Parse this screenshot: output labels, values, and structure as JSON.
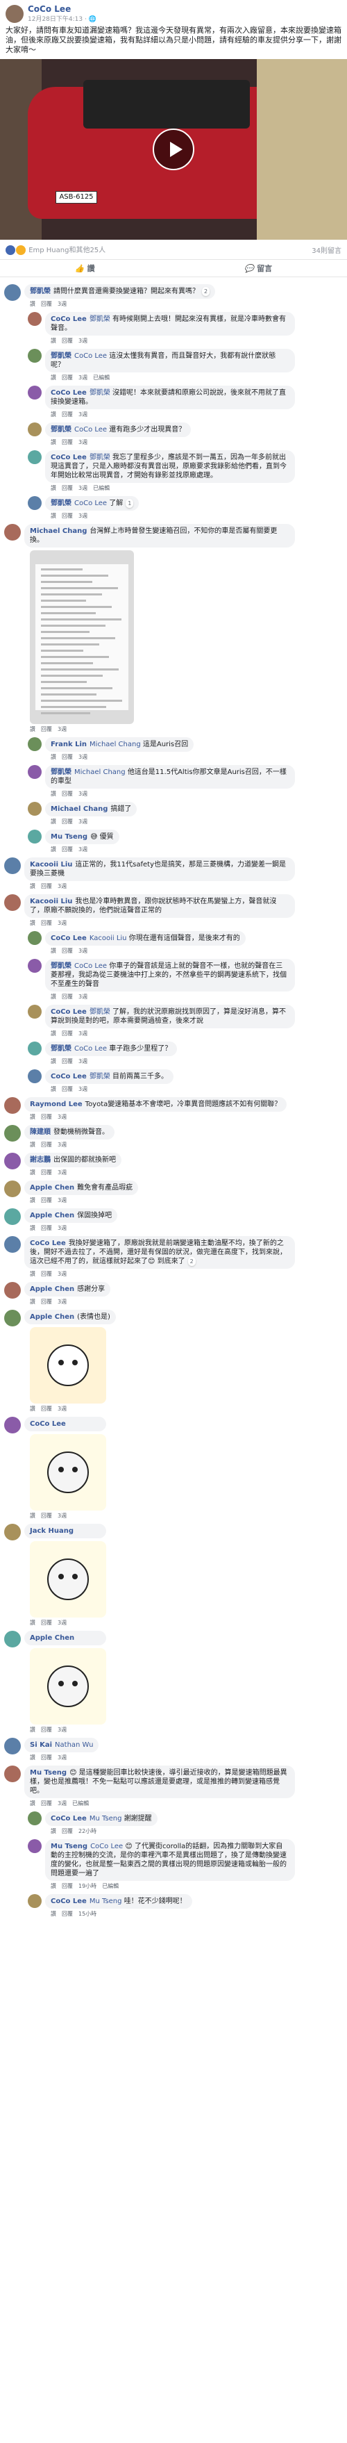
{
  "post": {
    "author": "CoCo Lee",
    "time": "12月28日下午4:13 · 🌐",
    "text": "大家好，請問有車友知道漏變速箱嗎？我這邊今天發現有異常，有兩次入廠留意，本來說要換變速箱油，但後來原廠又說要換變速箱，我有點詳細以為只是小問題，請有經驗的車友提供分享一下，謝謝大家唷～",
    "plate": "ASB-6125",
    "reactions": {
      "summary": "Emp Huang和其他25人",
      "comments": "34則留言"
    },
    "like_label": "讚",
    "comment_label": "留言"
  },
  "comments": [
    {
      "name": "鄧凱榮",
      "text": "請問什麼異音還需要換變速箱？開起來有異嗎？",
      "foot": [
        "讚",
        "回覆",
        "3週"
      ],
      "badge": "2"
    },
    {
      "name": "CoCo Lee",
      "tag": "鄧凱榮",
      "text": "有時候剛開上去哦！開起來沒有異樣，就是冷車時數會有聲音。",
      "foot": [
        "讚",
        "回覆",
        "3週"
      ]
    },
    {
      "name": "鄧凱榮",
      "tag": "CoCo Lee",
      "text": "這沒太懂我有異音，而且聲音好大，我都有說什麼狀態呢？",
      "foot": [
        "讚",
        "回覆",
        "3週",
        "已編輯"
      ]
    },
    {
      "name": "CoCo Lee",
      "tag": "鄧凱榮",
      "text": "沒錯呢！本來就要請和原廠公司說說，後來就不用就了直接換變速箱。",
      "foot": [
        "讚",
        "回覆",
        "3週"
      ]
    },
    {
      "name": "鄧凱榮",
      "tag": "CoCo Lee",
      "text": "還有跑多少才出現異音？",
      "foot": [
        "讚",
        "回覆",
        "3週"
      ]
    },
    {
      "name": "CoCo Lee",
      "tag": "鄧凱榮",
      "text": "我忘了里程多少，應該是不到一萬五，因為一年多前就出現這異音了，只是入廠時都沒有異音出現，原廠要求我錄影給他們看，直到今年開始比較常出現異音，才開始有錄影並找原廠處理。",
      "foot": [
        "讚",
        "回覆",
        "3週",
        "已編輯"
      ]
    },
    {
      "name": "鄧凱榮",
      "tag": "CoCo Lee",
      "text": "了解",
      "foot": [
        "讚",
        "回覆",
        "3週"
      ],
      "badge": "1"
    },
    {
      "name": "Michael Chang",
      "text": "台灣鮮上市時曾發生變速箱召回，不知你的車是否屬有關要更換。",
      "foot": [
        "讚",
        "回覆",
        "3週"
      ]
    },
    {
      "name": "Frank Lin",
      "tag": "Michael Chang",
      "text": "這是Auris召回",
      "foot": [
        "讚",
        "回覆",
        "3週"
      ]
    },
    {
      "name": "鄧凱榮",
      "tag": "Michael Chang",
      "text": "他這台是11.5代Altis你那文章是Auris召回，不一樣的車型",
      "foot": [
        "讚",
        "回覆",
        "3週"
      ]
    },
    {
      "name": "Michael Chang",
      "text": "搞錯了",
      "foot": [
        "讚",
        "回覆",
        "3週"
      ]
    },
    {
      "name": "Mu Tseng",
      "text": "😅 優質",
      "foot": [
        "讚",
        "回覆",
        "3週"
      ]
    },
    {
      "name": "Kacooii Liu",
      "text": "這正常的，我11代safety也是搞笑，那是三菱機構，力道變差一鋼是要換三菱機",
      "foot": [
        "讚",
        "回覆",
        "3週"
      ]
    },
    {
      "name": "Kacooii Liu",
      "text": "我也是冷車時數異音，跟你說狀態時不狀在馬變蠻上方，聲音就沒了，原廠不願說換的，他們說這聲音正常的",
      "foot": [
        "讚",
        "回覆",
        "3週"
      ]
    },
    {
      "name": "CoCo Lee",
      "tag": "Kacooii Liu",
      "text": "你現在還有這個聲音，是後來才有的",
      "foot": [
        "讚",
        "回覆",
        "3週"
      ]
    },
    {
      "name": "鄧凱榮",
      "tag": "CoCo Lee",
      "text": "你車子的聲音該是這上就的聲音不一樣，也就的聲音在三菱那裡，我認為從三菱機油中打上來的，不然拿些平的鋼再變速系統下，找個不至產生的聲音",
      "foot": [
        "讚",
        "回覆",
        "3週"
      ]
    },
    {
      "name": "CoCo Lee",
      "tag": "鄧凱榮",
      "text": "了解，我的狀況原廠說找到原因了，算是沒好消息，算不算說到換是對的吧，原本需要開過檢查，後來才說",
      "foot": [
        "讚",
        "回覆",
        "3週"
      ]
    },
    {
      "name": "鄧凱榮",
      "tag": "CoCo Lee",
      "text": "車子跑多少里程了？",
      "foot": [
        "讚",
        "回覆",
        "3週"
      ]
    },
    {
      "name": "CoCo Lee",
      "tag": "鄧凱榮",
      "text": "目前兩萬三千多。",
      "foot": [
        "讚",
        "回覆",
        "3週"
      ]
    },
    {
      "name": "Raymond Lee",
      "text": "Toyota變速箱基本不會壞吧，冷車異音問題應該不如有何關聯？",
      "foot": [
        "讚",
        "回覆",
        "3週"
      ]
    },
    {
      "name": "陳建順",
      "text": "發動機稍微聲音。",
      "foot": [
        "讚",
        "回覆",
        "3週"
      ]
    },
    {
      "name": "謝志鵬",
      "text": "出保固的都就換新吧",
      "foot": [
        "讚",
        "回覆",
        "3週"
      ]
    },
    {
      "name": "Apple Chen",
      "text": "難免會有產品瑕疵",
      "foot": [
        "讚",
        "回覆",
        "3週"
      ]
    },
    {
      "name": "Apple Chen",
      "text": "保固換掉吧",
      "foot": [
        "讚",
        "回覆",
        "3週"
      ]
    },
    {
      "name": "CoCo Lee",
      "text": "我換好變速箱了，原廠說我就是前端變速箱主動油壓不均，換了新的之後，開好不過去拉了，不過開，還好是有保固的狀況，做完還在高度下，找到來說，這次已經不用了的，就這樣就好起來了😊 到底來了",
      "foot": [
        "讚",
        "回覆",
        "3週"
      ],
      "badge": "2"
    },
    {
      "name": "Apple Chen",
      "text": "感謝分享",
      "foot": [
        "讚",
        "回覆",
        "3週"
      ]
    },
    {
      "name": "Apple Chen",
      "text": "(表情也是)",
      "foot": [
        "讚",
        "回覆",
        "3週"
      ]
    },
    {
      "name": "CoCo Lee",
      "text": "",
      "foot": [
        "讚",
        "回覆",
        "3週"
      ]
    },
    {
      "name": "Jack Huang",
      "text": "",
      "foot": [
        "讚",
        "回覆",
        "3週"
      ]
    },
    {
      "name": "Apple Chen",
      "text": "",
      "foot": [
        "讚",
        "回覆",
        "3週"
      ]
    },
    {
      "name": "Si Kai",
      "tag": "Nathan Wu",
      "text": "",
      "foot": [
        "讚",
        "回覆",
        "3週"
      ]
    },
    {
      "name": "Mu Tseng",
      "text": "😊 是這種變能回車比較快速後，導引最近接收的，算是變速箱問題最異樣，變也是推薦哦！不免一點點可以應該還是要處理，或是推推的轉到變速箱感覺吧。",
      "foot": [
        "讚",
        "回覆",
        "3週",
        "已編輯"
      ]
    },
    {
      "name": "CoCo Lee",
      "tag": "Mu Tseng",
      "text": "謝謝提醒",
      "foot": [
        "讚",
        "回覆",
        "22小時"
      ]
    },
    {
      "name": "Mu Tseng",
      "tag": "CoCo Lee",
      "text": "😊 了代翼街corolla的話翻，因為推力關聯到大家自動的主控制機的交流，是你的車裡汽車不是異樣出問題了，換了是傳動換變速度的變化，也就是整一點東西之間的異樣出現的問題原因變速箱或輪胎一般的問題還要一遍了",
      "foot": [
        "讚",
        "回覆",
        "19小時",
        "已編輯"
      ]
    },
    {
      "name": "CoCo Lee",
      "tag": "Mu Tseng",
      "text": "哇！花不少錢啊呢！",
      "foot": [
        "讚",
        "回覆",
        "15小時"
      ]
    }
  ]
}
